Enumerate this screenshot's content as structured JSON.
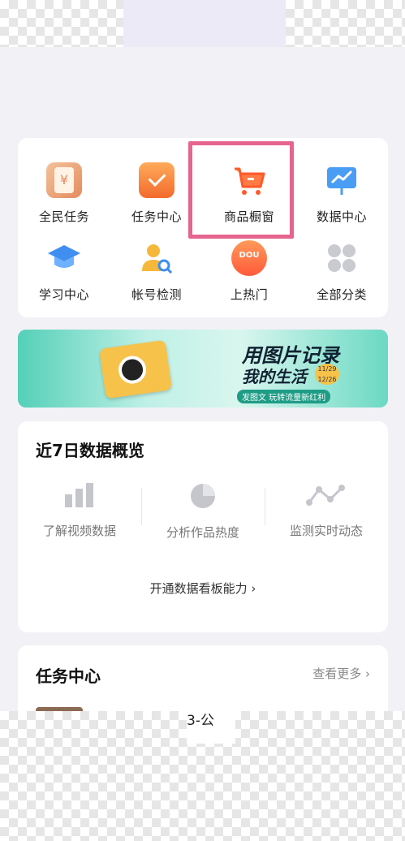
{
  "tools": [
    {
      "label": "全民任务",
      "icon": "yen-coupon-icon"
    },
    {
      "label": "任务中心",
      "icon": "calendar-check-icon"
    },
    {
      "label": "商品橱窗",
      "icon": "shopping-cart-icon"
    },
    {
      "label": "数据中心",
      "icon": "trend-board-icon"
    },
    {
      "label": "学习中心",
      "icon": "graduation-cap-icon"
    },
    {
      "label": "帐号检测",
      "icon": "user-search-icon"
    },
    {
      "label": "上热门",
      "icon": "dou-plus-icon"
    },
    {
      "label": "全部分类",
      "icon": "grid-icon"
    }
  ],
  "banner": {
    "title_line1": "用图片记录",
    "title_line2": "我的生活",
    "date": "11/29 12/26",
    "subtitle": "发图文 玩转流量新红利"
  },
  "data_overview": {
    "title": "近7日数据概览",
    "items": [
      {
        "label": "了解视频数据",
        "icon": "bar-chart-icon"
      },
      {
        "label": "分析作品热度",
        "icon": "pie-chart-icon"
      },
      {
        "label": "监测实时动态",
        "icon": "line-trend-icon"
      }
    ],
    "link": "开通数据看板能力 ›"
  },
  "task_center": {
    "title": "任务中心",
    "more": "查看更多 ›"
  },
  "partial_text": "3-公",
  "top_partial": "ios"
}
